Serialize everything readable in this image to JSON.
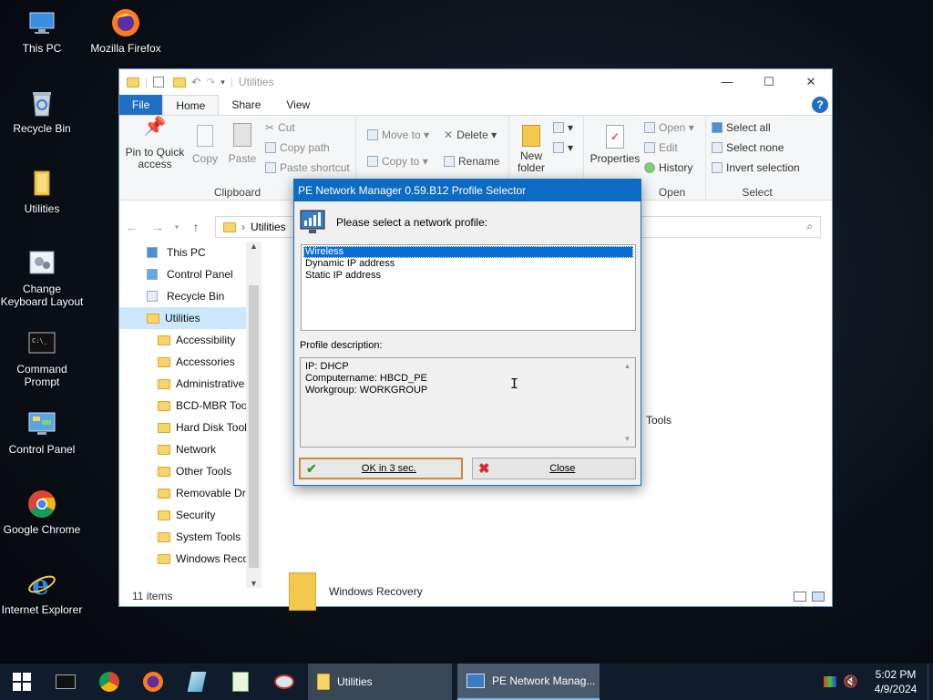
{
  "desktop": {
    "icons": [
      {
        "label": "This PC",
        "icon": "this-pc-icon"
      },
      {
        "label": "Mozilla Firefox",
        "icon": "firefox-icon"
      },
      {
        "label": "Recycle Bin",
        "icon": "recycle-bin-icon"
      },
      {
        "label": "Utilities",
        "icon": "folder-icon"
      },
      {
        "label": "Change Keyboard Layout",
        "icon": "keyboard-layout-icon"
      },
      {
        "label": "Command Prompt",
        "icon": "command-prompt-icon"
      },
      {
        "label": "Control Panel",
        "icon": "control-panel-icon"
      },
      {
        "label": "Google Chrome",
        "icon": "chrome-icon"
      },
      {
        "label": "Internet Explorer",
        "icon": "internet-explorer-icon"
      }
    ]
  },
  "explorer": {
    "title": "Utilities",
    "tabs": [
      "File",
      "Home",
      "Share",
      "View"
    ],
    "ribbon": {
      "clipboard": {
        "pin": "Pin to Quick access",
        "copy": "Copy",
        "paste": "Paste",
        "cut": "Cut",
        "copy_path": "Copy path",
        "paste_shortcut": "Paste shortcut",
        "label": "Clipboard"
      },
      "organize": {
        "move_to": "Move to",
        "copy_to": "Copy to",
        "delete": "Delete",
        "rename": "Rename"
      },
      "new": {
        "new_folder": "New folder"
      },
      "open": {
        "properties": "Properties",
        "open": "Open",
        "edit": "Edit",
        "history": "History",
        "label": "Open"
      },
      "select": {
        "select_all": "Select all",
        "select_none": "Select none",
        "invert": "Invert selection",
        "label": "Select"
      }
    },
    "address": "Utilities",
    "nav_items": [
      {
        "label": "This PC",
        "level": 0
      },
      {
        "label": "Control Panel",
        "level": 0
      },
      {
        "label": "Recycle Bin",
        "level": 0
      },
      {
        "label": "Utilities",
        "level": 0,
        "selected": true
      },
      {
        "label": "Accessibility",
        "level": 1
      },
      {
        "label": "Accessories",
        "level": 1
      },
      {
        "label": "Administrative",
        "level": 1
      },
      {
        "label": "BCD-MBR Tool",
        "level": 1
      },
      {
        "label": "Hard Disk Tools",
        "level": 1
      },
      {
        "label": "Network",
        "level": 1
      },
      {
        "label": "Other Tools",
        "level": 1
      },
      {
        "label": "Removable Dri",
        "level": 1
      },
      {
        "label": "Security",
        "level": 1
      },
      {
        "label": "System Tools",
        "level": 1
      },
      {
        "label": "Windows Reco",
        "level": 1
      }
    ],
    "content_items": [
      "Tools",
      "Windows Recovery"
    ],
    "status": "11 items"
  },
  "dialog": {
    "title": "PE Network Manager 0.59.B12 Profile Selector",
    "prompt": "Please select a network profile:",
    "profiles": [
      "Wireless",
      "Dynamic IP address",
      "Static IP address"
    ],
    "selected_profile": "Wireless",
    "description_label": "Profile description:",
    "description_lines": [
      "IP: DHCP",
      "Computername: HBCD_PE",
      "Workgroup: WORKGROUP"
    ],
    "ok_label": "OK in 3 sec.",
    "close_label": "Close"
  },
  "taskbar": {
    "apps": [
      {
        "label": "Utilities",
        "icon": "folder-icon"
      },
      {
        "label": "PE Network Manag...",
        "icon": "network-manager-icon"
      }
    ],
    "time": "5:02 PM",
    "date": "4/9/2024"
  },
  "colors": {
    "accent": "#0c6cc4",
    "selection": "#cce8ff",
    "taskbar": "#101b2b"
  }
}
